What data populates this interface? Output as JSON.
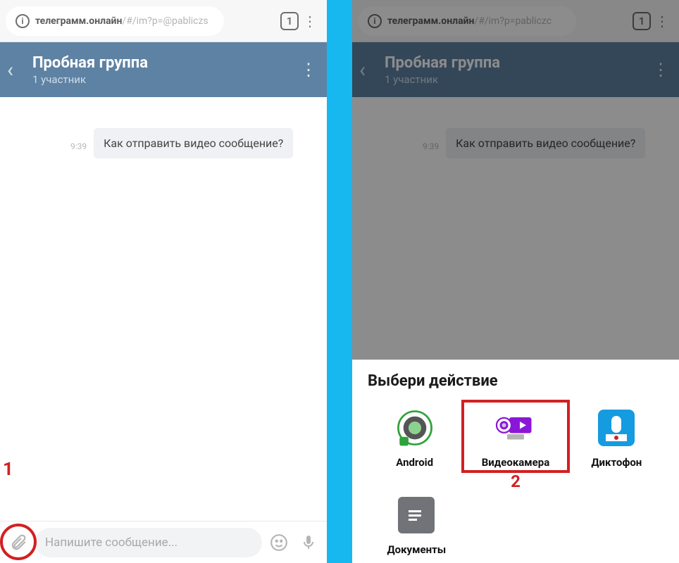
{
  "left": {
    "url": {
      "bold": "телеграмм.онлайн",
      "rest": "/#/im?p=@pabliczs"
    },
    "tabs_count": "1",
    "chat": {
      "title": "Пробная группа",
      "subtitle": "1 участник"
    },
    "message": {
      "time": "9:39",
      "text": "Как отправить видео сообщение?"
    },
    "input_placeholder": "Напишите сообщение...",
    "marker": "1"
  },
  "right": {
    "url": {
      "bold": "телеграмм.онлайн",
      "rest": "/#/im?p=pabliczc"
    },
    "tabs_count": "1",
    "chat": {
      "title": "Пробная группа",
      "subtitle": "1 участник"
    },
    "message": {
      "time": "9:39",
      "text": "Как отправить видео сообщение?"
    },
    "sheet": {
      "title": "Выбери действие",
      "items": {
        "android": "Android",
        "camcorder": "Видеокамера",
        "dictaphone": "Диктофон",
        "documents": "Документы"
      },
      "marker": "2"
    }
  }
}
